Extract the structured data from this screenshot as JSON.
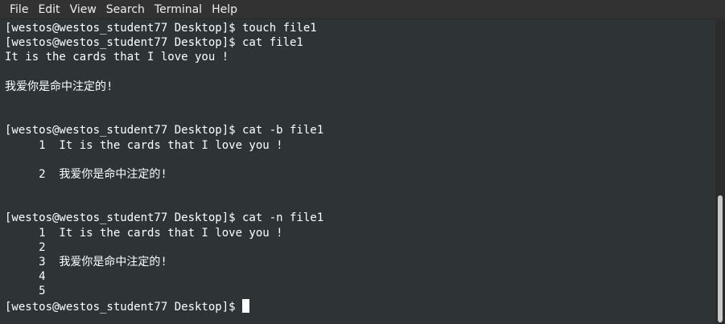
{
  "menubar": {
    "items": [
      "File",
      "Edit",
      "View",
      "Search",
      "Terminal",
      "Help"
    ]
  },
  "terminal": {
    "lines": [
      "[westos@westos_student77 Desktop]$ touch file1",
      "[westos@westos_student77 Desktop]$ cat file1",
      "It is the cards that I love you !",
      "",
      "我爱你是命中注定的!",
      "",
      "",
      "[westos@westos_student77 Desktop]$ cat -b file1",
      "     1  It is the cards that I love you !",
      "",
      "     2  我爱你是命中注定的!",
      "",
      "",
      "[westos@westos_student77 Desktop]$ cat -n file1",
      "     1  It is the cards that I love you !",
      "     2",
      "     3  我爱你是命中注定的!",
      "     4",
      "     5"
    ],
    "prompt": "[westos@westos_student77 Desktop]$ "
  },
  "colors": {
    "background": "#2e3436",
    "text": "#ffffff",
    "menubar": "#323232"
  }
}
